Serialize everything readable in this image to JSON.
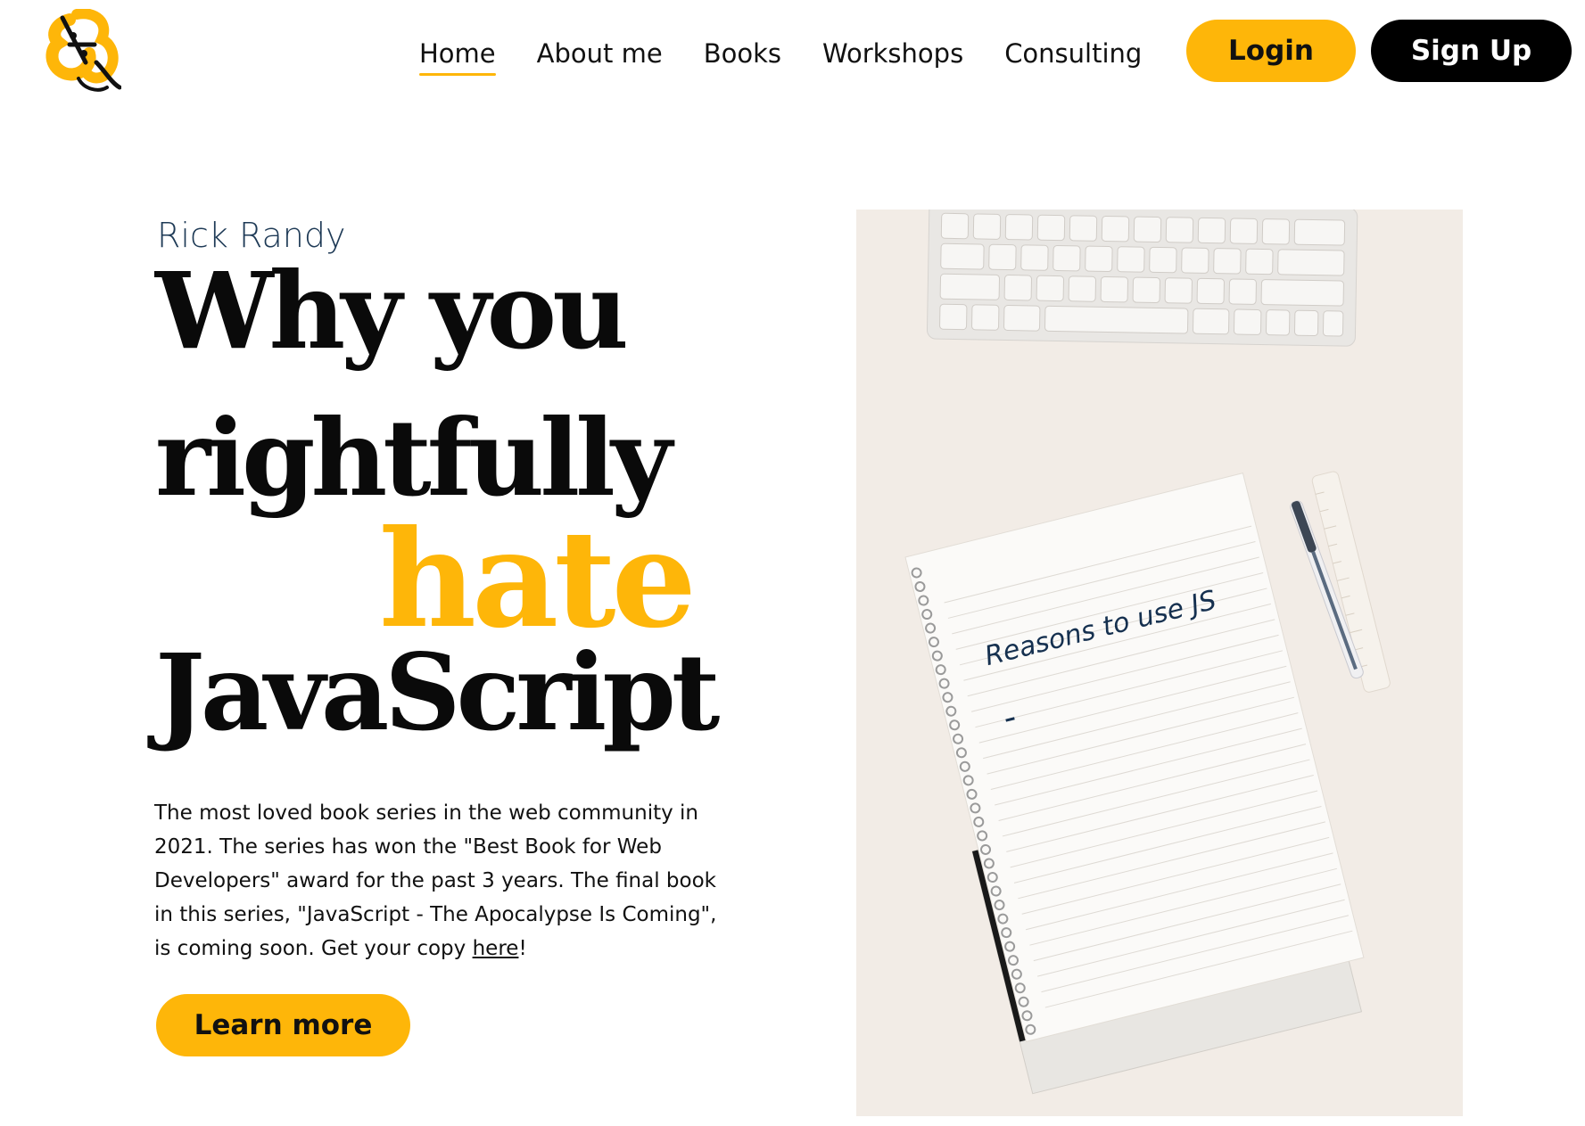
{
  "header": {
    "logo_icon": "ampersand-logo-icon",
    "nav": [
      {
        "label": "Home",
        "active": true
      },
      {
        "label": "About me",
        "active": false
      },
      {
        "label": "Books",
        "active": false
      },
      {
        "label": "Workshops",
        "active": false
      },
      {
        "label": "Consulting",
        "active": false
      }
    ],
    "login_label": "Login",
    "signup_label": "Sign Up"
  },
  "hero": {
    "author": "Rick Randy",
    "headline": {
      "line1": "Why you",
      "line2": "rightfully",
      "line3": "hate",
      "line4": "JavaScript"
    },
    "description_text": "The most loved book series in the web community in 2021. The series has won the \"Best Book for Web Developers\" award for the past 3 years. The final book in this series, \"JavaScript - The Apocalypse Is Coming\", is coming soon. Get your copy ",
    "description_link": "here",
    "description_end": "!",
    "learn_more_label": "Learn more"
  },
  "photo": {
    "notebook_text": "Reasons to use JS"
  },
  "colors": {
    "accent": "#FEB609",
    "dark": "#000000",
    "author": "#1e3a56",
    "photo_bg": "#f2ece6"
  }
}
